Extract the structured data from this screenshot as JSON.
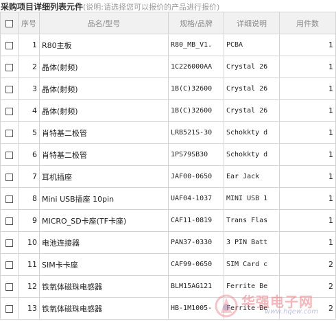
{
  "header": {
    "title": "采购项目详细列表元件",
    "note": "(说明:请选择您可以报价的产品进行报价)"
  },
  "table": {
    "columns": [
      "序号",
      "品名/型号",
      "规格/品牌",
      "详细说明",
      "用件数"
    ],
    "rows": [
      {
        "seq": "1",
        "name": "R80主板",
        "spec": "R80_MB_V1.",
        "desc": "PCBA",
        "qty": "1"
      },
      {
        "seq": "2",
        "name": "晶体(射频)",
        "spec": "1C226000AA",
        "desc": "Crystal 26",
        "qty": "1"
      },
      {
        "seq": "3",
        "name": "晶体(射频)",
        "spec": "1B(C)32600",
        "desc": "Crystal 26",
        "qty": "1"
      },
      {
        "seq": "4",
        "name": "晶体(射频)",
        "spec": "1B(C)32600",
        "desc": "Crystal 26",
        "qty": "1"
      },
      {
        "seq": "5",
        "name": "肖特基二极管",
        "spec": "LRB521S-30",
        "desc": "Schokkty d",
        "qty": "1"
      },
      {
        "seq": "6",
        "name": "肖特基二极管",
        "spec": "1PS79SB30",
        "desc": "Schokkty d",
        "qty": "1"
      },
      {
        "seq": "7",
        "name": "耳机插座",
        "spec": "JAF00-0650",
        "desc": "Ear Jack",
        "qty": "1"
      },
      {
        "seq": "8",
        "name": "Mini USB插座 10pin",
        "spec": "UAF04-1037",
        "desc": "MINI USB 1",
        "qty": "1"
      },
      {
        "seq": "9",
        "name": "MICRO_SD卡座(TF卡座)",
        "spec": "CAF11-0819",
        "desc": "Trans Flas",
        "qty": "1"
      },
      {
        "seq": "10",
        "name": "电池连接器",
        "spec": "PAN37-0330",
        "desc": "3 PIN Batt",
        "qty": "1"
      },
      {
        "seq": "11",
        "name": "SIM卡卡座",
        "spec": "CAF99-0650",
        "desc": "SIM Card c",
        "qty": "2"
      },
      {
        "seq": "12",
        "name": "铁氧体磁珠电感器",
        "spec": "BLM15AG121",
        "desc": "Ferrite Be",
        "qty": "2"
      },
      {
        "seq": "13",
        "name": "铁氧体磁珠电感器",
        "spec": "HB-1M1005-",
        "desc": "Ferrite Be",
        "qty": "2"
      }
    ]
  },
  "watermark": {
    "text": "华强电子网",
    "url": "www.hqew.com",
    "color": "#f07882"
  }
}
